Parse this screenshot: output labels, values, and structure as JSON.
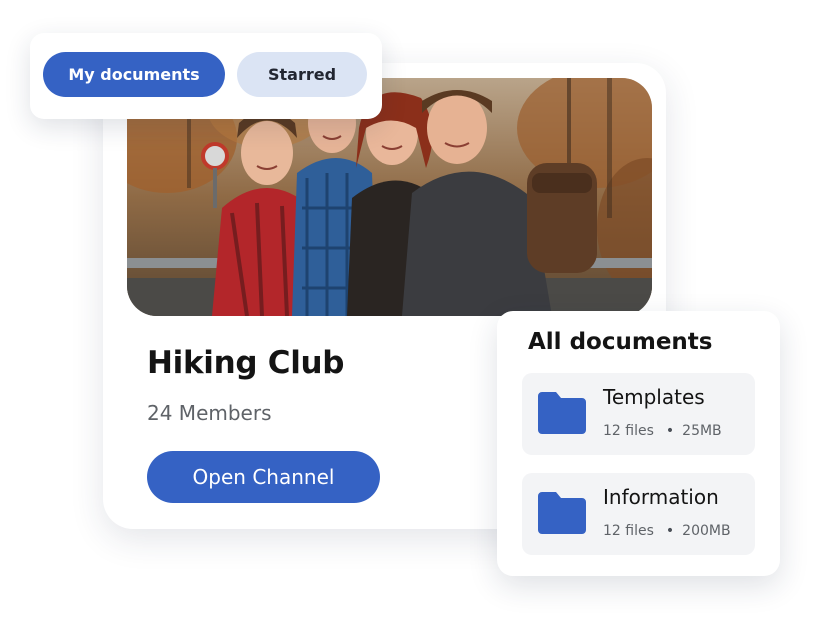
{
  "tabs": {
    "my_documents_label": "My documents",
    "starred_label": "Starred",
    "active": "My documents"
  },
  "channel": {
    "title": "Hiking Club",
    "members": "24 Members",
    "open_label": "Open Channel",
    "photo_icon": "group-photo"
  },
  "documents": {
    "title": "All documents",
    "folders": [
      {
        "name": "Templates",
        "files": "12 files",
        "size": "25MB",
        "icon": "folder-icon"
      },
      {
        "name": "Information",
        "files": "12 files",
        "size": "200MB",
        "icon": "folder-icon"
      }
    ]
  },
  "colors": {
    "accent": "#3562c4",
    "tab_inactive_bg": "#dbe4f4",
    "folder_bg": "#f3f4f6",
    "folder_icon": "#3562c4"
  }
}
